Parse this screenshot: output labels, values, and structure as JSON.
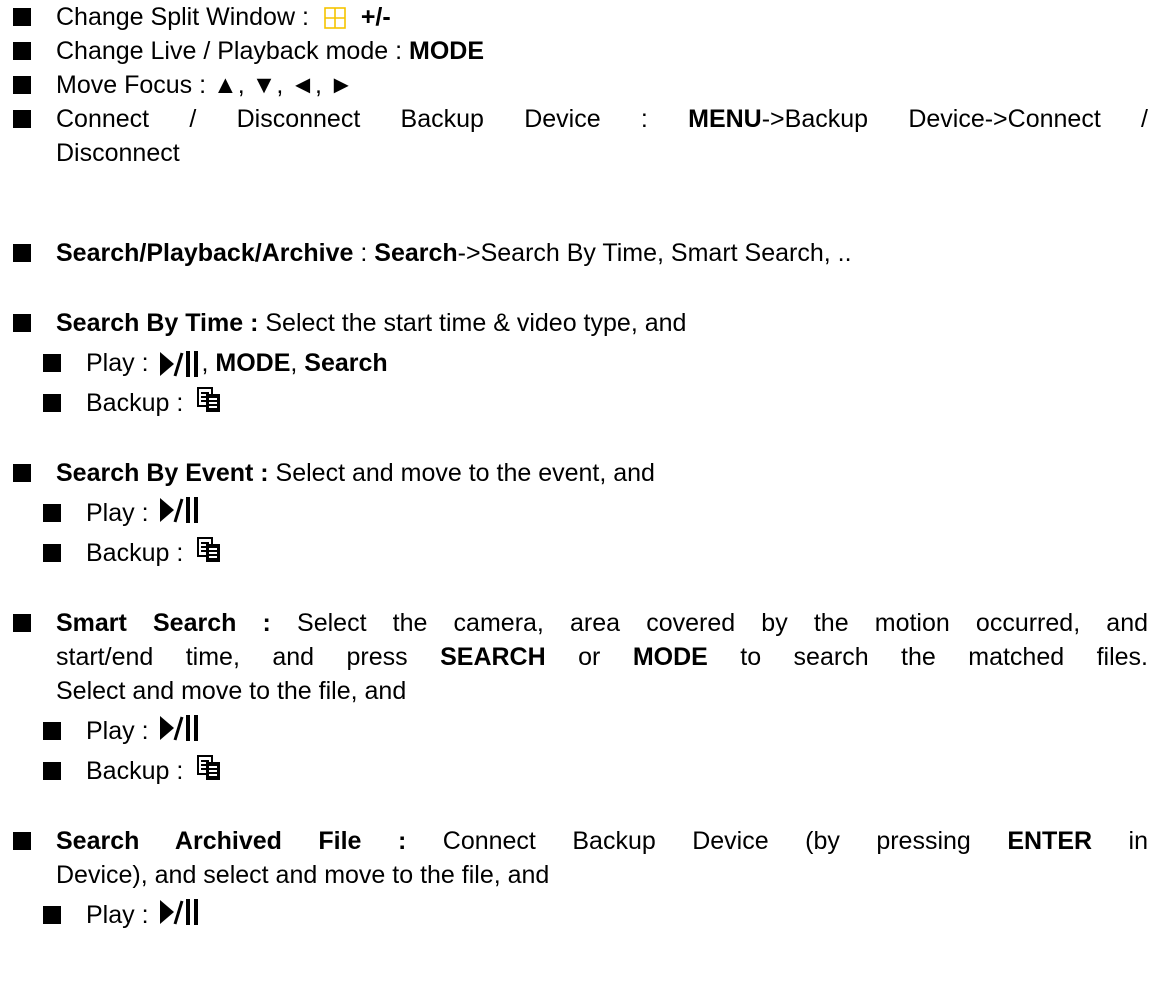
{
  "line1": {
    "label": "Change Split Window :",
    "symbol": "+/-",
    "icon": "split-window-grid-icon"
  },
  "line2": {
    "label": "Change Live / Playback mode :",
    "key": "MODE"
  },
  "line3": {
    "label": "Move Focus : ▲, ▼, ◄, ►"
  },
  "line4": {
    "label_a": "Connect / Disconnect Backup Device :",
    "key": "MENU",
    "label_b": "->Backup Device->Connect /",
    "label_c": "Disconnect"
  },
  "line5": {
    "title": "Search/Playback/Archive",
    "sep": ":",
    "key": "Search",
    "rest": "->Search By Time, Smart Search, .."
  },
  "sec_time": {
    "title": "Search By Time :",
    "desc": "Select the start time & video type, and",
    "play": "Play :",
    "sep": ",",
    "mode": "MODE",
    "search": "Search",
    "backup": "Backup :"
  },
  "sec_event": {
    "title": "Search By Event :",
    "desc": "Select and move to the event, and",
    "play": "Play :",
    "backup": "Backup :"
  },
  "sec_smart": {
    "title": "Smart Search :",
    "l1": "Select the camera, area covered by the motion occurred, and",
    "l2a": "start/end time, and press",
    "k1": "SEARCH",
    "l2b": "or",
    "k2": "MODE",
    "l2c": "to search the matched files.",
    "l3": "Select and move to the file, and",
    "play": "Play :",
    "backup": "Backup :"
  },
  "sec_archive": {
    "title": "Search Archived File :",
    "l1a": "Connect Backup Device (by pressing",
    "k1": "ENTER",
    "l1b": "in",
    "l2": "Device), and select and move to the file, and",
    "play": "Play :"
  },
  "icons": {
    "bullet": "square-bullet-icon",
    "play_pause": "play-pause-icon",
    "backup": "backup-copy-icon"
  },
  "colors": {
    "grid_icon": "#f5c400",
    "text": "#000000"
  }
}
